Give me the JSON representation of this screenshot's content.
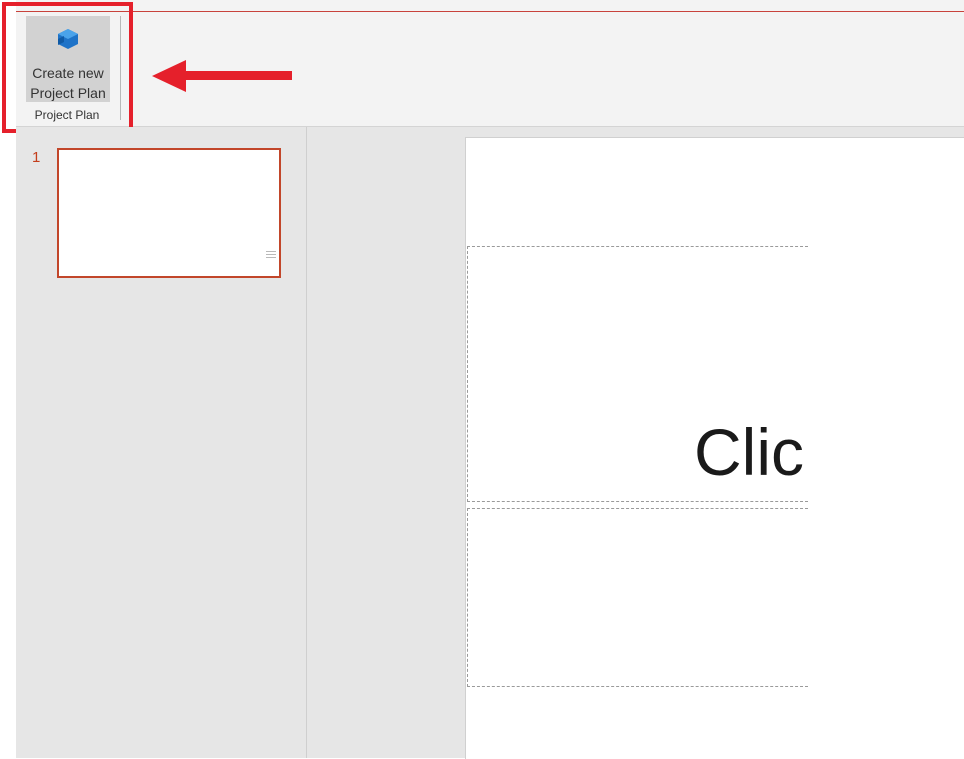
{
  "ribbon": {
    "button": {
      "label": "Create new\nProject Plan",
      "icon": "cube-icon",
      "icon_color": "#1e73c8"
    },
    "group_label": "Project Plan"
  },
  "annotation": {
    "highlight_color": "#e5202b"
  },
  "thumbnails": [
    {
      "number": "1"
    }
  ],
  "slide": {
    "title_placeholder_text": "Clic"
  }
}
